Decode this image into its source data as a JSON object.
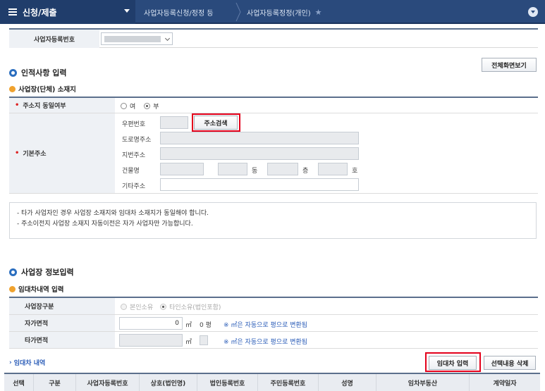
{
  "nav": {
    "menu_title": "신청/제출",
    "crumb1": "사업자등록신청/정정 등",
    "crumb2": "사업자등록정정(개인)"
  },
  "business": {
    "label": "사업자등록번호"
  },
  "section1": {
    "title": "인적사항 입력",
    "fullscreen_label": "전체화면보기",
    "subtitle": "사업장(단체) 소재지",
    "same_address_label": "주소지 동일여부",
    "radio_yes": "여",
    "radio_no": "부",
    "base_address_label": "기본주소",
    "postal_label": "우편번호",
    "address_search_label": "주소검색",
    "road_label": "도로명주소",
    "lot_label": "지번주소",
    "building_label": "건물명",
    "dong_unit": "동",
    "floor_unit": "층",
    "room_unit": "호",
    "other_label": "기타주소"
  },
  "notice": {
    "line1": "- 타가 사업자인 경우 사업장 소재지와 임대차 소재지가 동일해야 합니다.",
    "line2": "- 주소이전지 사업장 소재지 자동이전은 자가 사업자만 가능합니다."
  },
  "section2": {
    "title": "사업장 정보입력",
    "subtitle": "임대차내역 입력",
    "type_label": "사업장구분",
    "type_opt1": "본인소유",
    "type_opt2": "타인소유(법인포함)",
    "own_area_label": "자가면적",
    "own_area_value": "0",
    "m2": "㎡",
    "pyeong_value": "0 평",
    "convert_note": "※ ㎡은 자동으로 평으로 변환됨",
    "other_area_label": "타가면적",
    "lease_list_label": "임대차 내역",
    "lease_input_label": "임대차 입력",
    "delete_label": "선택내용 삭제"
  },
  "grid": {
    "columns": [
      "선택",
      "구분",
      "사업자등록번호",
      "상호(법인명)",
      "법인등록번호",
      "주민등록번호",
      "성명",
      "임차부동산",
      "계약일자"
    ]
  },
  "colors": {
    "nav_bg": "#2a4a7c",
    "accent_blue": "#2b6ebf",
    "accent_orange": "#f0a22e",
    "highlight_red": "#e3001b"
  }
}
